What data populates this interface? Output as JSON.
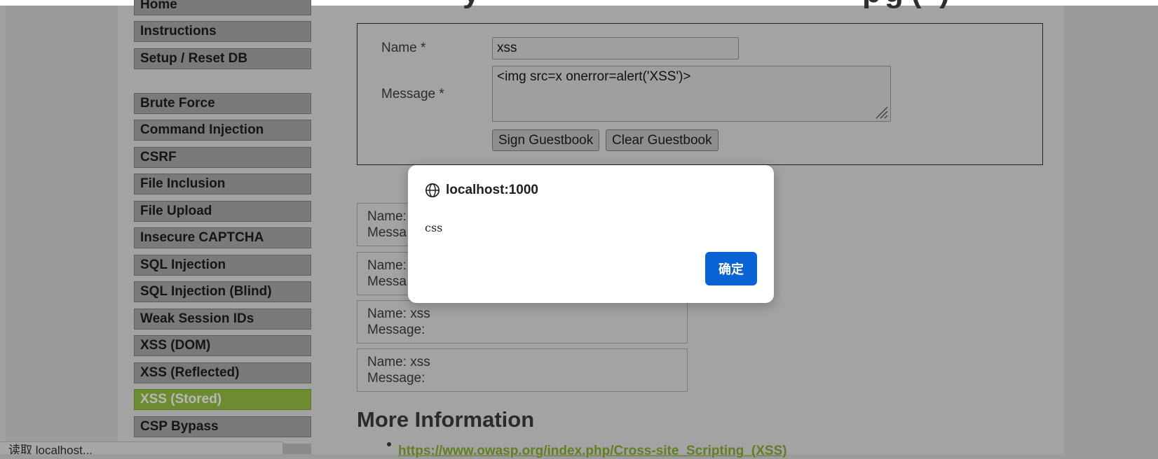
{
  "menu": {
    "items": [
      {
        "label": "Home"
      },
      {
        "label": "Instructions"
      },
      {
        "label": "Setup / Reset DB"
      },
      {
        "label": "Brute Force"
      },
      {
        "label": "Command Injection"
      },
      {
        "label": "CSRF"
      },
      {
        "label": "File Inclusion"
      },
      {
        "label": "File Upload"
      },
      {
        "label": "Insecure CAPTCHA"
      },
      {
        "label": "SQL Injection"
      },
      {
        "label": "SQL Injection (Blind)"
      },
      {
        "label": "Weak Session IDs"
      },
      {
        "label": "XSS (DOM)"
      },
      {
        "label": "XSS (Reflected)"
      },
      {
        "label": "XSS (Stored)",
        "active": true
      },
      {
        "label": "CSP Bypass"
      }
    ]
  },
  "form": {
    "name_label": "Name *",
    "name_value": "xss",
    "message_label": "Message *",
    "message_value": "<img src=x onerror=alert('XSS')>",
    "sign_button": "Sign Guestbook",
    "clear_button": "Clear Guestbook"
  },
  "entries": [
    {
      "name": "Name:",
      "message": "Messa"
    },
    {
      "name": "Name:",
      "message": "Messa"
    },
    {
      "name": "Name: xss",
      "message": "Message:"
    },
    {
      "name": "Name: xss",
      "message": "Message:"
    }
  ],
  "more_info": {
    "heading": "More Information",
    "link": "https://www.owasp.org/index.php/Cross-site_Scripting_(XSS)"
  },
  "dialog": {
    "origin": "localhost:1000",
    "message": "css",
    "ok_label": "确定",
    "icon": "globe-icon",
    "ok_color": "#0b64d6"
  },
  "statusbar": {
    "text": "读取 localhost..."
  },
  "colors": {
    "active_menu": "#6d8b30",
    "link": "#5f7f22"
  }
}
